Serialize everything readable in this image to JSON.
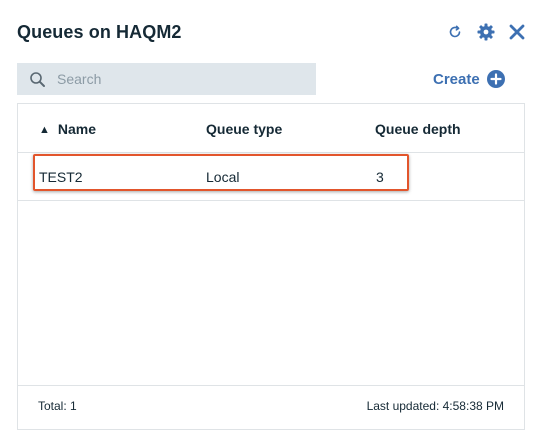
{
  "header": {
    "title": "Queues on HAQM2",
    "icons": [
      "refresh-icon",
      "gear-icon",
      "close-icon"
    ],
    "accent_color": "#3d70b2"
  },
  "search": {
    "placeholder": "Search",
    "value": ""
  },
  "create": {
    "label": "Create"
  },
  "table": {
    "columns": [
      "Name",
      "Queue type",
      "Queue depth"
    ],
    "sort_column": "Name",
    "sort_direction": "ascending",
    "rows": [
      {
        "name": "TEST2",
        "type": "Local",
        "depth": "3"
      }
    ],
    "highlight_color": "#e2552c"
  },
  "footer": {
    "total": "Total: 1",
    "last_updated": "Last updated: 4:58:38 PM"
  }
}
